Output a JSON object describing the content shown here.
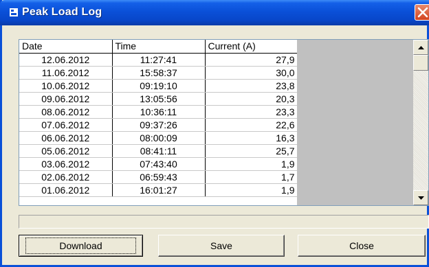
{
  "window": {
    "title": "Peak Load Log"
  },
  "columns": [
    "Date",
    "Time",
    "Current (A)"
  ],
  "rows": [
    {
      "date": "12.06.2012",
      "time": "11:27:41",
      "current": "27,9"
    },
    {
      "date": "11.06.2012",
      "time": "15:58:37",
      "current": "30,0"
    },
    {
      "date": "10.06.2012",
      "time": "09:19:10",
      "current": "23,8"
    },
    {
      "date": "09.06.2012",
      "time": "13:05:56",
      "current": "20,3"
    },
    {
      "date": "08.06.2012",
      "time": "10:36:11",
      "current": "23,3"
    },
    {
      "date": "07.06.2012",
      "time": "09:37:26",
      "current": "22,6"
    },
    {
      "date": "06.06.2012",
      "time": "08:00:09",
      "current": "16,3"
    },
    {
      "date": "05.06.2012",
      "time": "08:41:11",
      "current": "25,7"
    },
    {
      "date": "03.06.2012",
      "time": "07:43:40",
      "current": "1,9"
    },
    {
      "date": "02.06.2012",
      "time": "06:59:43",
      "current": "1,7"
    },
    {
      "date": "01.06.2012",
      "time": "16:01:27",
      "current": "1,9"
    }
  ],
  "status_text": "",
  "buttons": {
    "download": "Download",
    "save": "Save",
    "close": "Close"
  },
  "colors": {
    "titlebar": "#0a50d8",
    "window_bg": "#ece9d8",
    "grid_filler": "#c0c0c0",
    "close_red": "#d3431f"
  }
}
